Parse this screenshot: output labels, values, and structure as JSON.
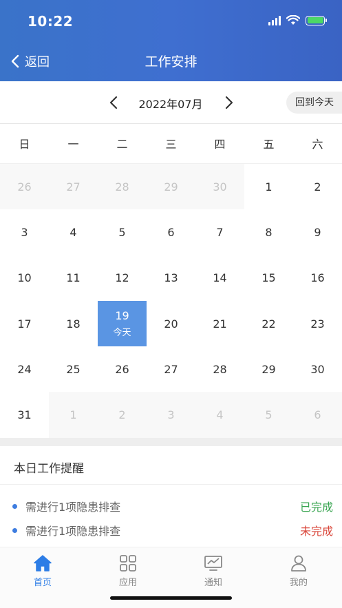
{
  "status_bar": {
    "time": "10:22"
  },
  "header": {
    "back_label": "返回",
    "title": "工作安排"
  },
  "month_nav": {
    "label": "2022年07月",
    "today_button": "回到今天"
  },
  "weekdays": [
    "日",
    "一",
    "二",
    "三",
    "四",
    "五",
    "六"
  ],
  "calendar": {
    "today_label": "今天",
    "days": [
      {
        "day": "26",
        "other": true
      },
      {
        "day": "27",
        "other": true
      },
      {
        "day": "28",
        "other": true
      },
      {
        "day": "29",
        "other": true
      },
      {
        "day": "30",
        "other": true
      },
      {
        "day": "1"
      },
      {
        "day": "2"
      },
      {
        "day": "3"
      },
      {
        "day": "4"
      },
      {
        "day": "5"
      },
      {
        "day": "6"
      },
      {
        "day": "7"
      },
      {
        "day": "8"
      },
      {
        "day": "9"
      },
      {
        "day": "10"
      },
      {
        "day": "11"
      },
      {
        "day": "12"
      },
      {
        "day": "13"
      },
      {
        "day": "14"
      },
      {
        "day": "15"
      },
      {
        "day": "16"
      },
      {
        "day": "17"
      },
      {
        "day": "18"
      },
      {
        "day": "19",
        "today": true
      },
      {
        "day": "20"
      },
      {
        "day": "21"
      },
      {
        "day": "22"
      },
      {
        "day": "23"
      },
      {
        "day": "24"
      },
      {
        "day": "25"
      },
      {
        "day": "26"
      },
      {
        "day": "27"
      },
      {
        "day": "28"
      },
      {
        "day": "29"
      },
      {
        "day": "30"
      },
      {
        "day": "31"
      },
      {
        "day": "1",
        "other": true
      },
      {
        "day": "2",
        "other": true
      },
      {
        "day": "3",
        "other": true
      },
      {
        "day": "4",
        "other": true
      },
      {
        "day": "5",
        "other": true
      },
      {
        "day": "6",
        "other": true
      }
    ]
  },
  "reminders": {
    "title": "本日工作提醒",
    "items": [
      {
        "text": "需进行1项隐患排查",
        "status": "已完成",
        "status_color": "#3aa552"
      },
      {
        "text": "需进行1项隐患排查",
        "status": "未完成",
        "status_color": "#d9463a"
      }
    ]
  },
  "tabbar": {
    "active_color": "#2d7de6",
    "inactive_color": "#888888",
    "tabs": [
      {
        "label": "首页",
        "icon": "home-icon",
        "active": true
      },
      {
        "label": "应用",
        "icon": "apps-grid-icon"
      },
      {
        "label": "通知",
        "icon": "monitor-chart-icon"
      },
      {
        "label": "我的",
        "icon": "person-icon"
      }
    ]
  }
}
